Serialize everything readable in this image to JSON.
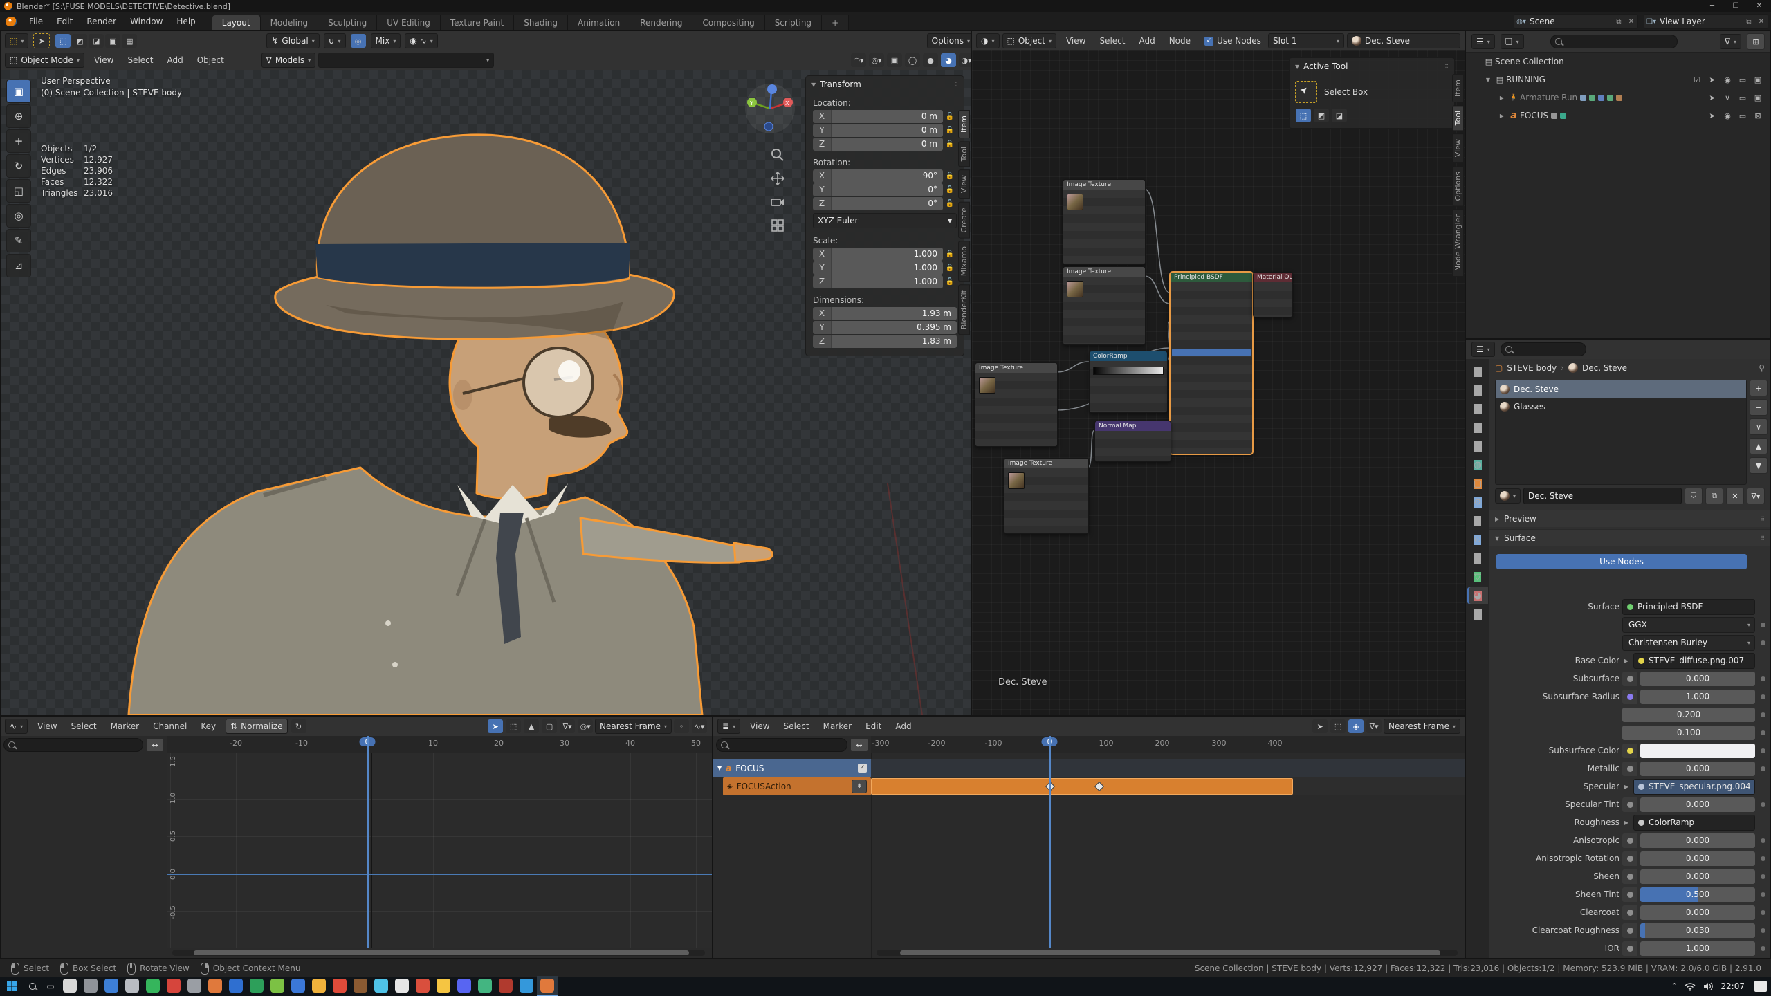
{
  "titlebar": {
    "title": "Blender* [S:\\FUSE MODELS\\DETECTIVE\\Detective.blend]",
    "minimize": "─",
    "maximize": "☐",
    "close": "✕"
  },
  "topbar": {
    "menus": [
      {
        "label": "File"
      },
      {
        "label": "Edit"
      },
      {
        "label": "Render"
      },
      {
        "label": "Window"
      },
      {
        "label": "Help"
      }
    ],
    "tabs": [
      {
        "label": "Layout",
        "cls": "on"
      },
      {
        "label": "Modeling"
      },
      {
        "label": "Sculpting"
      },
      {
        "label": "UV Editing"
      },
      {
        "label": "Texture Paint"
      },
      {
        "label": "Shading"
      },
      {
        "label": "Animation"
      },
      {
        "label": "Rendering"
      },
      {
        "label": "Compositing"
      },
      {
        "label": "Scripting"
      },
      {
        "label": "+"
      }
    ],
    "scene_label": "Scene",
    "view_layer_label": "View Layer"
  },
  "tool_settings": {
    "orientation": "Global",
    "blend": "Mix",
    "options": "Options"
  },
  "viewport": {
    "mode": "Object Mode",
    "menus": [
      {
        "label": "View"
      },
      {
        "label": "Select"
      },
      {
        "label": "Add"
      },
      {
        "label": "Object"
      }
    ],
    "collection": "Models",
    "toolbar": [
      {
        "g": "▣",
        "cls": "on"
      },
      {
        "g": "⊕"
      },
      {
        "g": "+"
      },
      {
        "g": "↻"
      },
      {
        "g": "◱"
      },
      {
        "g": "◎"
      },
      {
        "g": "✎"
      },
      {
        "g": "⊿"
      }
    ],
    "overlay": {
      "perspective": "User Perspective",
      "context": "(0) Scene Collection | STEVE body"
    },
    "stats": [
      {
        "label": "Objects",
        "value": "1/2"
      },
      {
        "label": "Vertices",
        "value": "12,927"
      },
      {
        "label": "Edges",
        "value": "23,906"
      },
      {
        "label": "Faces",
        "value": "12,322"
      },
      {
        "label": "Triangles",
        "value": "23,016"
      }
    ],
    "n_panel": {
      "title": "Transform",
      "groups": [
        {
          "title": "Location:",
          "rows": [
            {
              "axis": "X",
              "value": "0 m",
              "lock": 1
            },
            {
              "axis": "Y",
              "value": "0 m",
              "lock": 1
            },
            {
              "axis": "Z",
              "value": "0 m",
              "lock": 1
            }
          ]
        },
        {
          "title": "Rotation:",
          "rows": [
            {
              "axis": "X",
              "value": "-90°",
              "lock": 1
            },
            {
              "axis": "Y",
              "value": "0°",
              "lock": 1
            },
            {
              "axis": "Z",
              "value": "0°",
              "lock": 1
            }
          ],
          "mode": "XYZ Euler"
        },
        {
          "title": "Scale:",
          "rows": [
            {
              "axis": "X",
              "value": "1.000",
              "lock": 1
            },
            {
              "axis": "Y",
              "value": "1.000",
              "lock": 1
            },
            {
              "axis": "Z",
              "value": "1.000",
              "lock": 1
            }
          ]
        },
        {
          "title": "Dimensions:",
          "rows": [
            {
              "axis": "X",
              "value": "1.93 m"
            },
            {
              "axis": "Y",
              "value": "0.395 m"
            },
            {
              "axis": "Z",
              "value": "1.83 m"
            }
          ]
        }
      ],
      "tabs": [
        {
          "label": "Item",
          "cls": "on"
        },
        {
          "label": "Tool"
        },
        {
          "label": "View"
        },
        {
          "label": "Create"
        },
        {
          "label": "Mixamo"
        },
        {
          "label": "BlenderKit"
        }
      ]
    }
  },
  "shader": {
    "type_label": "Object",
    "menus": [
      {
        "label": "View"
      },
      {
        "label": "Select"
      },
      {
        "label": "Add"
      },
      {
        "label": "Node"
      }
    ],
    "use_nodes": "Use Nodes",
    "slot": "Slot 1",
    "material": "Dec. Steve",
    "overlay_label": "Dec. Steve",
    "active_tool": {
      "title": "Active Tool",
      "tool": "Select Box"
    },
    "side_tabs": [
      {
        "label": "Item"
      },
      {
        "label": "Tool",
        "cls": "on"
      },
      {
        "label": "View"
      },
      {
        "label": "Options"
      },
      {
        "label": "Node Wrangler"
      }
    ],
    "nodes": [
      {
        "title": "Image Texture",
        "css": "left:131px;top:186px;width:118px;height:122px",
        "hdr": "background:#474747",
        "thumb": 1
      },
      {
        "title": "Image Texture",
        "css": "left:131px;top:312px;width:118px;height:112px",
        "hdr": "background:#474747",
        "thumb": 1
      },
      {
        "title": "Image Texture",
        "css": "left:4px;top:451px;width:118px;height:120px",
        "hdr": "background:#474747",
        "thumb": 1
      },
      {
        "title": "ColorRamp",
        "css": "left:169px;top:434px;width:112px;height:88px",
        "hdr": "background:#1d4e6e",
        "ramp": 1
      },
      {
        "title": "Principled BSDF",
        "css": "left:286px;top:320px;width:118px;height:262px",
        "hdr": "background:#2d5a3c",
        "selcls": "sel",
        "hl": 1
      },
      {
        "title": "Material Output",
        "css": "left:406px;top:320px;width:56px;height:64px",
        "hdr": "background:#5e2c34"
      },
      {
        "title": "Normal Map",
        "css": "left:177px;top:535px;width:109px;height:58px",
        "hdr": "background:#46366e"
      },
      {
        "title": "Image Texture",
        "css": "left:46px;top:589px;width:121px;height:108px",
        "hdr": "background:#474747",
        "thumb": 1
      }
    ],
    "links": [
      "M249,200 C272,200 264,350 286,350",
      "M249,326 C270,326 266,366 286,366",
      "M122,465 C146,465 146,450 169,450",
      "M281,448 C294,448 278,392 286,392",
      "M122,520 C220,520 210,430 286,430",
      "M167,603 C176,603 170,549 177,549",
      "M286,549 C300,549 300,560 286,562",
      "M404,334 L406,334"
    ]
  },
  "outliner": {
    "rows": [
      {
        "expander": "",
        "icon": "▤",
        "iconcss": "color:#c8c8c8",
        "label": "Scene Collection",
        "ind": "padding-left:8px",
        "rights": []
      },
      {
        "expander": "▼",
        "icon": "▤",
        "iconcss": "color:#c8c8c8",
        "label": "RUNNING",
        "ind": "padding-left:24px",
        "rights": [
          {
            "g": "☑"
          },
          {
            "g": "➤"
          },
          {
            "g": "◉"
          },
          {
            "g": "▭"
          },
          {
            "g": "▣"
          }
        ]
      },
      {
        "expander": "▶",
        "icon": "🧍",
        "iconcss": "color:#e0883a;font-size:10px",
        "label": "Armature Run",
        "cls": "dim",
        "ind": "padding-left:44px",
        "badges": [
          "#8fb3d9",
          "#63c08a",
          "#6b8fd9",
          "#63c08a",
          "#c98e5a"
        ],
        "rights": [
          {
            "g": "➤"
          },
          {
            "g": "∨"
          },
          {
            "g": "▭"
          },
          {
            "g": "▣"
          }
        ]
      },
      {
        "expander": "▶",
        "icon": "a",
        "iconcss": "color:#e0883a;font-style:italic;font-weight:bold;font-size:14px",
        "label": "FOCUS",
        "ind": "padding-left:44px",
        "badges": [
          "#aaaaaa",
          "#3fbf9f"
        ],
        "rights": [
          {
            "g": "➤"
          },
          {
            "g": "◉"
          },
          {
            "g": "▭"
          },
          {
            "g": "⊠"
          }
        ]
      }
    ]
  },
  "properties": {
    "breadcrumb": {
      "object": "STEVE body",
      "sep": "›",
      "material": "Dec. Steve"
    },
    "slots": [
      {
        "label": "Dec. Steve",
        "cls": "on"
      },
      {
        "label": "Glasses"
      }
    ],
    "slot_buttons": [
      {
        "g": "+"
      },
      {
        "g": "−"
      },
      {
        "g": "∨"
      },
      {
        "g": "▲"
      },
      {
        "g": "▼"
      }
    ],
    "name_field": "Dec. Steve",
    "preview_label": "Preview",
    "surface_label": "Surface",
    "use_nodes": "Use Nodes",
    "tabs": [
      {
        "g": "⚒",
        "c": "#a8a8a8"
      },
      {
        "g": "▤",
        "c": "#a8a8a8"
      },
      {
        "g": "▥",
        "c": "#a8a8a8"
      },
      {
        "g": "▦",
        "c": "#a8a8a8"
      },
      {
        "g": "▧",
        "c": "#a8a8a8"
      },
      {
        "g": "◍",
        "c": "#5ab0a0"
      },
      {
        "g": "▢",
        "c": "#e0883a"
      },
      {
        "g": "⚙",
        "c": "#80a8d8"
      },
      {
        "g": "✱",
        "c": "#a8a8a8"
      },
      {
        "g": "⊙",
        "c": "#80a8d8"
      },
      {
        "g": "⊞",
        "c": "#a8a8a8"
      },
      {
        "g": "▽",
        "c": "#58c07a"
      },
      {
        "g": "◕",
        "c": "#c87070",
        "cls": "on"
      },
      {
        "g": "▩",
        "c": "#a8a8a8"
      }
    ],
    "rows": [
      {
        "label": "Surface",
        "value": "Principled BSDF",
        "type": "ref",
        "dotcss": "background:#6fcf6f"
      },
      {
        "label": "",
        "value": "GGX",
        "type": "drop",
        "decor": 1,
        "car": 1
      },
      {
        "label": "",
        "value": "Christensen-Burley",
        "type": "drop",
        "decor": 1,
        "car": 1
      },
      {
        "label": "Base Color",
        "value": "STEVE_diffuse.png.007",
        "type": "ref",
        "expand": 1,
        "dotcss": "background:#e3d44a"
      },
      {
        "label": "Subsurface",
        "value": "0.000",
        "type": "slider",
        "sock": 1,
        "decor": 1
      },
      {
        "label": "Subsurface Radius",
        "value": "1.000",
        "type": "num",
        "sock": 1,
        "sockcss": "background:#8a7af0",
        "decor": 1
      },
      {
        "label": "",
        "value": "0.200",
        "type": "num",
        "decor": 1
      },
      {
        "label": "",
        "value": "0.100",
        "type": "num",
        "decor": 1
      },
      {
        "label": "Subsurface Color",
        "value": "",
        "type": "color",
        "swcss": "background:#f1f1f3",
        "sock": 1,
        "sockcss": "background:#e3d44a",
        "decor": 1
      },
      {
        "label": "Metallic",
        "value": "0.000",
        "type": "slider",
        "sock": 1,
        "decor": 1
      },
      {
        "label": "Specular",
        "value": "STEVE_specular.png.004",
        "type": "refsel",
        "expand": 1,
        "dotcss": "background:#b8c4d8"
      },
      {
        "label": "Specular Tint",
        "value": "0.000",
        "type": "slider",
        "sock": 1,
        "decor": 1
      },
      {
        "label": "Roughness",
        "value": "ColorRamp",
        "type": "ref",
        "expand": 1,
        "dotcss": "background:#c8c8c8"
      },
      {
        "label": "Anisotropic",
        "value": "0.000",
        "type": "slider",
        "sock": 1,
        "decor": 1
      },
      {
        "label": "Anisotropic Rotation",
        "value": "0.000",
        "type": "slider",
        "sock": 1,
        "decor": 1
      },
      {
        "label": "Sheen",
        "value": "0.000",
        "type": "slider",
        "sock": 1,
        "decor": 1
      },
      {
        "label": "Sheen Tint",
        "value": "0.500",
        "type": "slider",
        "sock": 1,
        "decor": 1,
        "fillcss": "width:50%"
      },
      {
        "label": "Clearcoat",
        "value": "0.000",
        "type": "slider",
        "sock": 1,
        "decor": 1
      },
      {
        "label": "Clearcoat Roughness",
        "value": "0.030",
        "type": "slider",
        "sock": 1,
        "decor": 1,
        "fillcss": "width:4%"
      },
      {
        "label": "IOR",
        "value": "1.000",
        "type": "slider",
        "sock": 1,
        "decor": 1
      }
    ]
  },
  "graph": {
    "menus": [
      {
        "label": "View"
      },
      {
        "label": "Select"
      },
      {
        "label": "Marker"
      },
      {
        "label": "Channel"
      },
      {
        "label": "Key"
      }
    ],
    "normalize": "Normalize",
    "snap": "Nearest Frame",
    "x_ticks": [
      {
        "t": "-20",
        "css": "left:100px"
      },
      {
        "t": "-10",
        "css": "left:195px"
      },
      {
        "t": "0",
        "css": "left:290px",
        "cls": "cur"
      },
      {
        "t": "10",
        "css": "left:385px"
      },
      {
        "t": "20",
        "css": "left:480px"
      },
      {
        "t": "30",
        "css": "left:575px"
      },
      {
        "t": "40",
        "css": "left:670px"
      },
      {
        "t": "50",
        "css": "left:765px"
      }
    ],
    "y_ticks": [
      {
        "t": "1.5",
        "css": "top:65px"
      },
      {
        "t": "1.0",
        "css": "top:118px"
      },
      {
        "t": "0.5",
        "css": "top:173px"
      },
      {
        "t": "0.0",
        "css": "top:228px"
      },
      {
        "t": "-0.5",
        "css": "top:283px"
      }
    ]
  },
  "nla": {
    "menus": [
      {
        "label": "View"
      },
      {
        "label": "Select"
      },
      {
        "label": "Marker"
      },
      {
        "label": "Edit"
      },
      {
        "label": "Add"
      }
    ],
    "snap": "Nearest Frame",
    "track": "FOCUS",
    "strip": "FOCUSAction",
    "x_ticks": [
      {
        "t": "-300",
        "css": "left:14px"
      },
      {
        "t": "-200",
        "css": "left:95px"
      },
      {
        "t": "-100",
        "css": "left:177px"
      },
      {
        "t": "0",
        "css": "left:258px",
        "cls": "cur"
      },
      {
        "t": "100",
        "css": "left:340px"
      },
      {
        "t": "200",
        "css": "left:421px"
      },
      {
        "t": "300",
        "css": "left:503px"
      },
      {
        "t": "400",
        "css": "left:584px"
      }
    ]
  },
  "status": {
    "items": [
      {
        "label": "Select",
        "btn": "l"
      },
      {
        "label": "Box Select",
        "btn": "l"
      },
      {
        "label": "Rotate View",
        "btn": "m"
      },
      {
        "label": "Object Context Menu",
        "btn": "r"
      }
    ],
    "right": "Scene Collection | STEVE body | Verts:12,927 | Faces:12,322 | Tris:23,016 | Objects:1/2 | Memory: 523.9 MiB | VRAM: 2.0/6.0 GiB | 2.91.0"
  },
  "taskbar": {
    "time": "22:07",
    "apps": [
      {
        "c": "#d8d8d8"
      },
      {
        "c": "#8f9399"
      },
      {
        "c": "#3d7fd6"
      },
      {
        "c": "#b8bcc2"
      },
      {
        "c": "#35b55c"
      },
      {
        "c": "#d6453c"
      },
      {
        "c": "#9a9ea4"
      },
      {
        "c": "#e0793c"
      },
      {
        "c": "#2f6fd0"
      },
      {
        "c": "#2d9f5a"
      },
      {
        "c": "#7cc144"
      },
      {
        "c": "#3b78d8"
      },
      {
        "c": "#f0b23c"
      },
      {
        "c": "#e04b3a"
      },
      {
        "c": "#8a5a32"
      },
      {
        "c": "#4fc3e8"
      },
      {
        "c": "#e6e6e6"
      },
      {
        "c": "#d94f3d"
      },
      {
        "c": "#f5c542"
      },
      {
        "c": "#5865f2"
      },
      {
        "c": "#43b581"
      },
      {
        "c": "#b03a2e"
      },
      {
        "c": "#3498db"
      },
      {
        "c": "#e0793c",
        "cls": "on"
      }
    ]
  }
}
